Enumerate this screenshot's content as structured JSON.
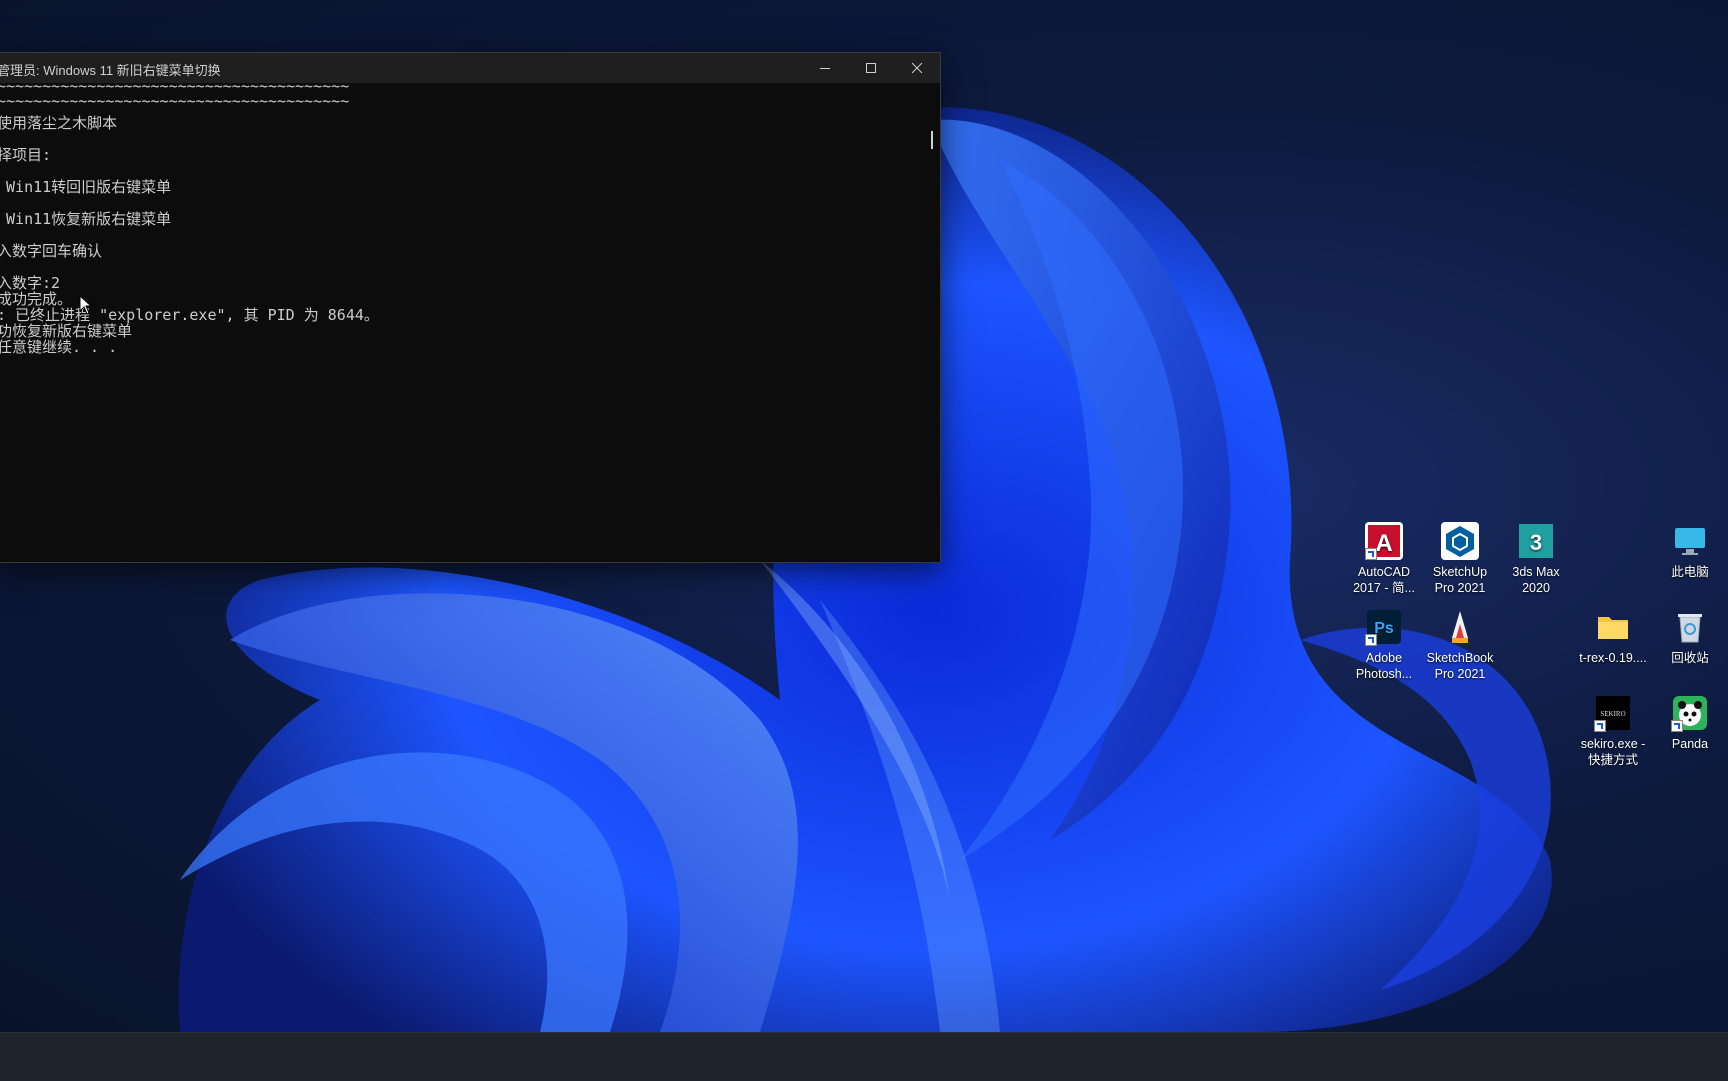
{
  "console": {
    "title": "管理员:  Windows 11 新旧右键菜单切换",
    "lines": [
      "~~~~~~~~~~~~~~~~~~~~~~~~~~~~~~~~~~~~~~~",
      "~~~~~~~~~~~~~~~~~~~~~~~~~~~~~~~~~~~~~~~",
      "使用落尘之木脚本",
      "择项目:",
      " Win11转回旧版右键菜单",
      " Win11恢复新版右键菜单",
      "入数字回车确认",
      "入数字:2",
      "成功完成。",
      ": 已终止进程 \"explorer.exe\", 其 PID 为 8644。",
      "功恢复新版右键菜单",
      "任意键继续. . ."
    ]
  },
  "desktop_icons": [
    {
      "label1": "AutoCAD",
      "label2": "2017 - 简...",
      "icon": "autocad-icon"
    },
    {
      "label1": "SketchUp",
      "label2": "Pro 2021",
      "icon": "sketchup-icon"
    },
    {
      "label1": "3ds Max",
      "label2": "2020",
      "icon": "3dsmax-icon"
    },
    {
      "label1": "此电脑",
      "label2": "",
      "icon": "this-pc-icon"
    },
    {
      "label1": "Adobe",
      "label2": "Photosh...",
      "icon": "photoshop-icon"
    },
    {
      "label1": "SketchBook",
      "label2": "Pro 2021",
      "icon": "sketchbook-icon"
    },
    {
      "label1": "t-rex-0.19....",
      "label2": "",
      "icon": "folder-icon"
    },
    {
      "label1": "回收站",
      "label2": "",
      "icon": "recycle-bin-icon"
    },
    {
      "label1": "sekiro.exe -",
      "label2": "快捷方式",
      "icon": "sekiro-icon"
    },
    {
      "label1": "Panda",
      "label2": "",
      "icon": "panda-icon"
    }
  ],
  "colors": {
    "console_bg": "#0c0c0c",
    "console_text": "#cccccc",
    "titlebar_bg": "#1f1f1f",
    "wallpaper_accent": "#1f4dff"
  }
}
